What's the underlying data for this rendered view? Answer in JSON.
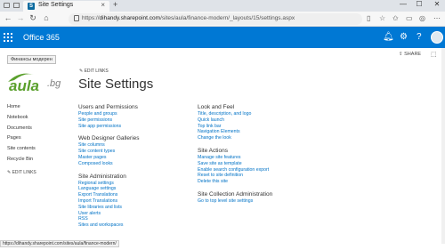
{
  "browser": {
    "tab_title": "Site Settings",
    "url_prefix": "https://",
    "url_host": "dihandy.sharepoint.com",
    "url_path": "/sites/aula/finance-modern/_layouts/15/settings.aspx",
    "new_tab": "+",
    "minimize": "—",
    "maximize": "☐",
    "close": "✕"
  },
  "suite": {
    "app_title": "Office 365"
  },
  "ribbon": {
    "share_label": "SHARE",
    "tooltip": "Финансы модерен"
  },
  "site": {
    "logo_text": "aula",
    "logo_suffix": ".bg",
    "edit_links": "EDIT LINKS",
    "page_title": "Site Settings"
  },
  "leftnav": {
    "items": [
      "Home",
      "Notebook",
      "Documents",
      "Pages",
      "Site contents",
      "Recycle Bin"
    ],
    "edit_links": "EDIT LINKS"
  },
  "sections": {
    "users": {
      "title": "Users and Permissions",
      "links": [
        "People and groups",
        "Site permissions",
        "Site app permissions"
      ]
    },
    "designer": {
      "title": "Web Designer Galleries",
      "links": [
        "Site columns",
        "Site content types",
        "Master pages",
        "Composed looks"
      ]
    },
    "admin": {
      "title": "Site Administration",
      "links": [
        "Regional settings",
        "Language settings",
        "Export Translations",
        "Import Translations",
        "Site libraries and lists",
        "User alerts",
        "RSS",
        "Sites and workspaces"
      ]
    },
    "look": {
      "title": "Look and Feel",
      "links": [
        "Title, description, and logo",
        "Quick launch",
        "Top link bar",
        "Navigation Elements",
        "Change the look"
      ]
    },
    "actions": {
      "title": "Site Actions",
      "links": [
        "Manage site features",
        "Save site as template",
        "Enable search configuration export",
        "Reset to site definition",
        "Delete this site"
      ]
    },
    "collection": {
      "title": "Site Collection Administration",
      "links": [
        "Go to top level site settings"
      ]
    }
  },
  "status": {
    "url": "https://dihandy.sharepoint.com/sites/aula/finance-modern/"
  },
  "colors": {
    "suite_blue": "#0078d4",
    "link_blue": "#0072c6",
    "logo_green": "#5aa02c"
  }
}
